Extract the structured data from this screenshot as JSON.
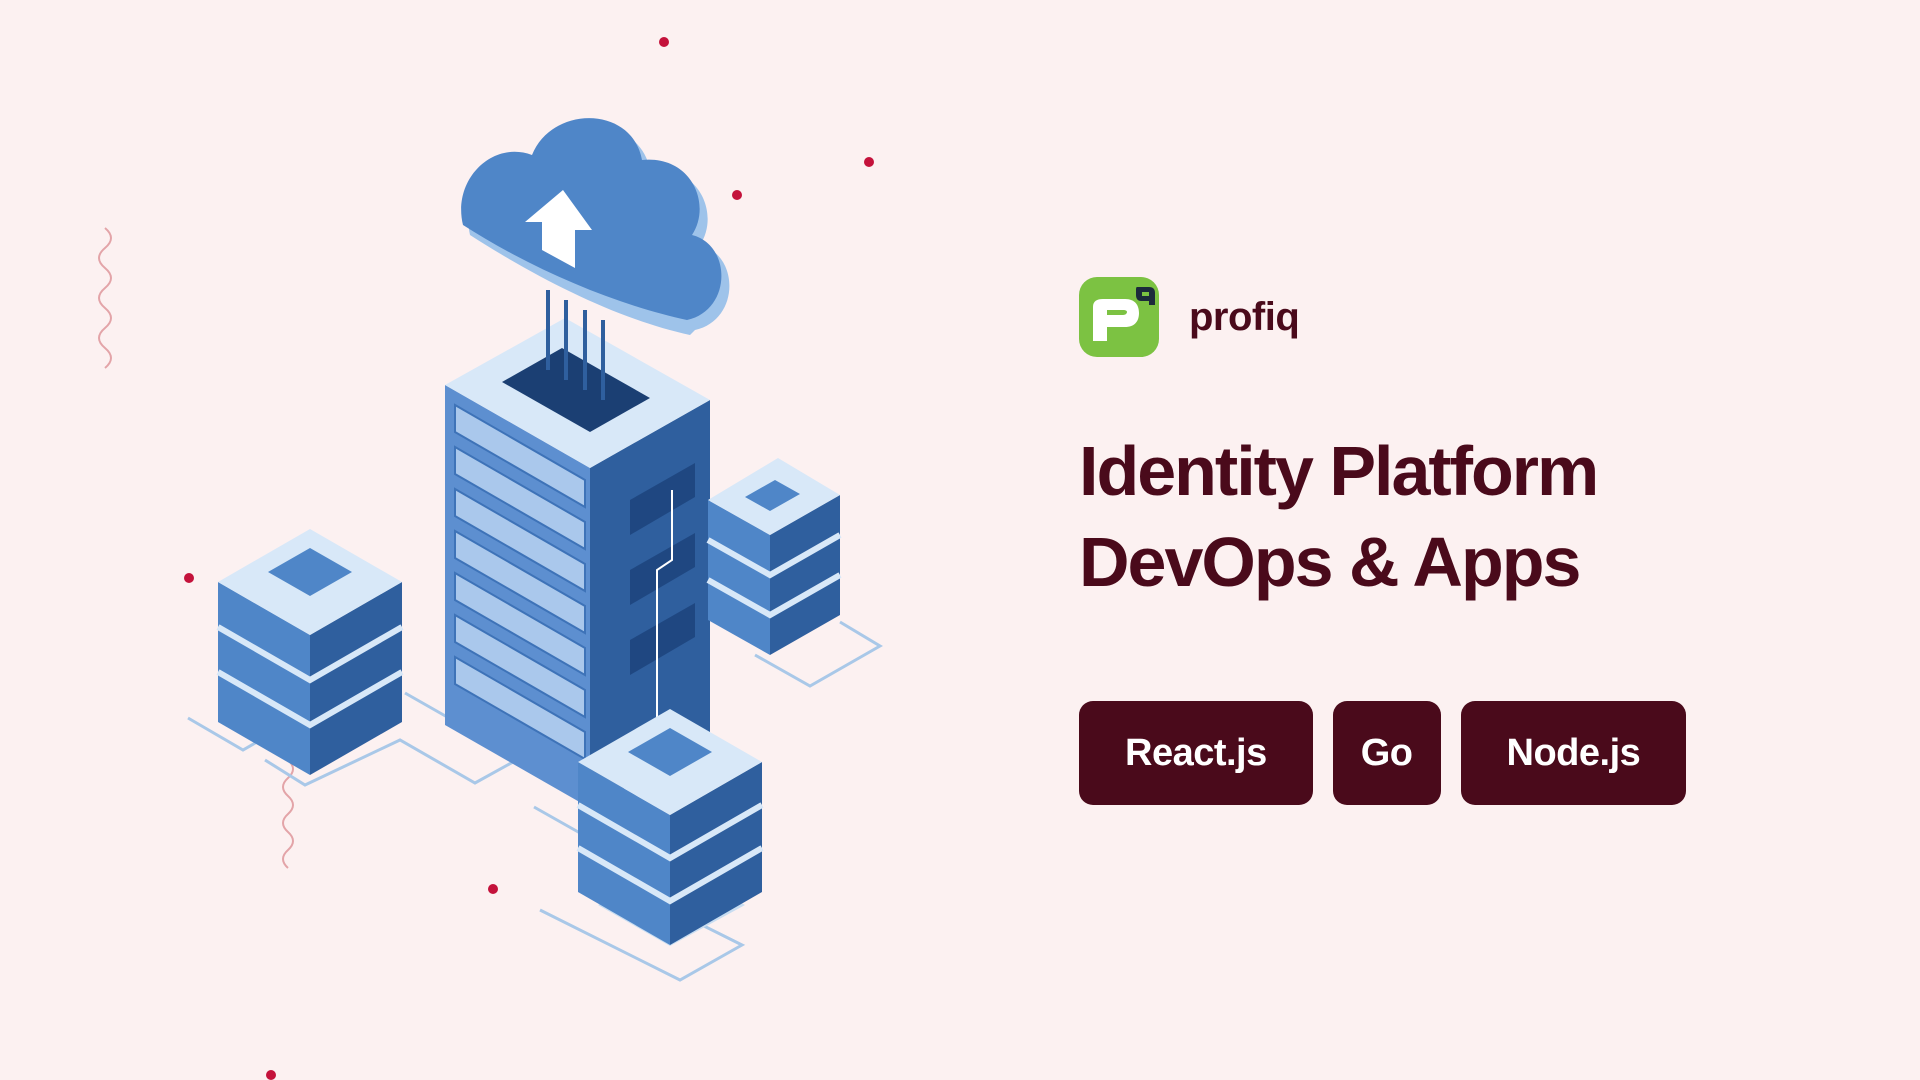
{
  "brand": {
    "name": "profiq",
    "logo_icon": "profiq-logo-icon",
    "logo_color": "#7cc242"
  },
  "headline": {
    "line1": "Identity Platform",
    "line2": "DevOps & Apps"
  },
  "tags": [
    {
      "label": "React.js"
    },
    {
      "label": "Go"
    },
    {
      "label": "Node.js"
    }
  ],
  "illustration": {
    "icon": "cloud-server-isometric-illustration",
    "accent_dot_color": "#c4123b",
    "primary_blue": "#3e73b8"
  },
  "colors": {
    "background": "#fcf1f1",
    "text_primary": "#4a0a1b",
    "tag_background": "#4a0a1b",
    "tag_text": "#ffffff"
  }
}
